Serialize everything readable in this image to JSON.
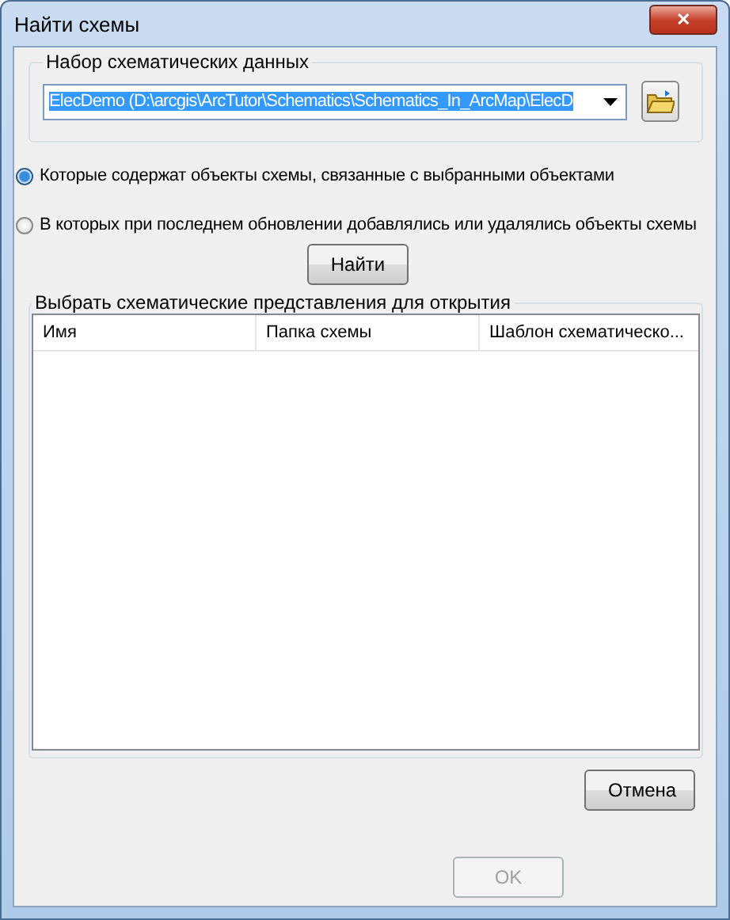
{
  "window": {
    "title": "Найти схемы",
    "close": "✕"
  },
  "dataset_group": {
    "label": "Набор схематических данных",
    "value": "ElecDemo (D:\\arcgis\\ArcTutor\\Schematics\\Schematics_In_ArcMap\\ElecD",
    "value_selected": true
  },
  "options": [
    {
      "label": "Которые содержат объекты схемы, связанные с выбранными объектами",
      "selected": true
    },
    {
      "label": "В которых при последнем обновлении добавлялись или удалялись объекты схемы",
      "selected": false
    }
  ],
  "find_button": {
    "label": "Найти",
    "disabled": false
  },
  "results_group": {
    "label": "Выбрать схематические представления для открытия",
    "columns": [
      "Имя",
      "Папка схемы",
      "Шаблон схематическо..."
    ]
  },
  "buttons": [
    {
      "label": "Отмена",
      "disabled": false
    },
    {
      "label": "OK",
      "disabled": true
    }
  ]
}
